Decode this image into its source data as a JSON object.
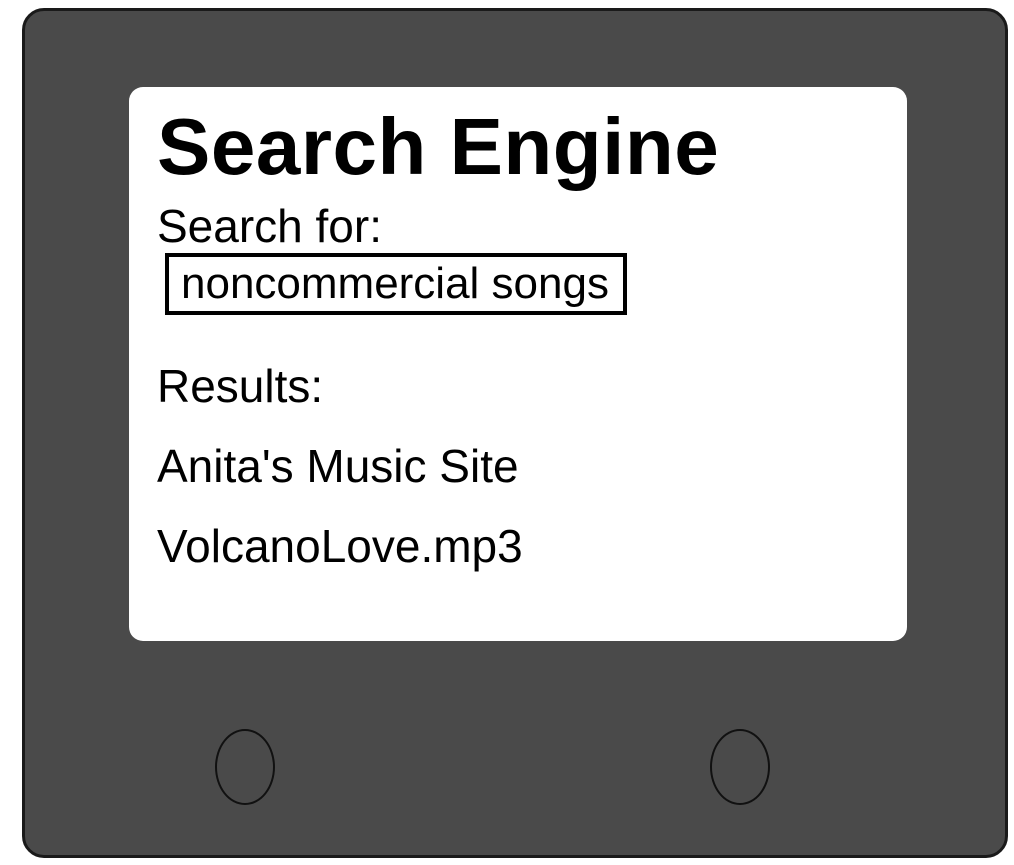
{
  "screen": {
    "title": "Search Engine",
    "search_label": "Search for:",
    "search_value": "noncommercial songs",
    "results_label": "Results:",
    "results": [
      "Anita's Music Site",
      "VolcanoLove.mp3"
    ]
  },
  "device": {
    "body_color": "#4a4a4a",
    "screen_color": "#ffffff"
  }
}
